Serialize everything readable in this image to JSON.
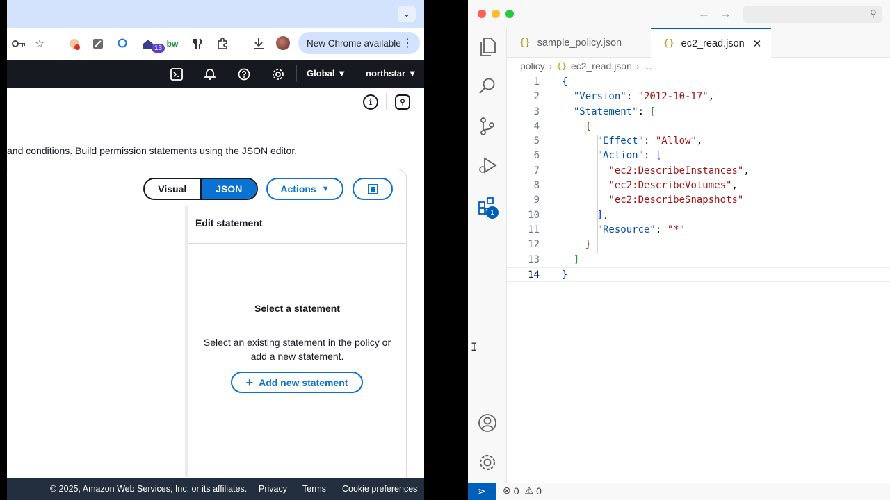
{
  "chrome": {
    "new_chrome_label": "New Chrome available",
    "extension_badge": "13",
    "extension_text_icon": "bw"
  },
  "aws_nav": {
    "region": "Global",
    "account": "northstar"
  },
  "policy_editor": {
    "description": "and conditions. Build permission statements using the JSON editor.",
    "mode_visual": "Visual",
    "mode_json": "JSON",
    "actions_label": "Actions",
    "edit_statement_title": "Edit statement",
    "select_statement_title": "Select a statement",
    "select_statement_desc": "Select an existing statement in the policy or add a new statement.",
    "add_statement_label": "Add new statement"
  },
  "aws_footer": {
    "copyright": "© 2025, Amazon Web Services, Inc. or its affiliates.",
    "privacy": "Privacy",
    "terms": "Terms",
    "cookies": "Cookie preferences"
  },
  "vscode": {
    "tabs": [
      {
        "braces": "{}",
        "label": "sample_policy.json"
      },
      {
        "braces": "{}",
        "label": "ec2_read.json"
      }
    ],
    "breadcrumb": {
      "folder": "policy",
      "braces": "{}",
      "file": "ec2_read.json",
      "more": "..."
    },
    "extensions_badge": "1",
    "line_numbers": [
      "1",
      "2",
      "3",
      "4",
      "5",
      "6",
      "7",
      "8",
      "9",
      "10",
      "11",
      "12",
      "13",
      "14"
    ],
    "status": {
      "errors": "0",
      "warnings": "0"
    }
  },
  "code": {
    "l1_open": "{",
    "version_key": "\"Version\"",
    "version_val": "\"2012-10-17\"",
    "statement_key": "\"Statement\"",
    "statement_open": "[",
    "obj_open": "{",
    "effect_key": "\"Effect\"",
    "effect_val": "\"Allow\"",
    "action_key": "\"Action\"",
    "action_open": "[",
    "action_1": "\"ec2:DescribeInstances\"",
    "action_2": "\"ec2:DescribeVolumes\"",
    "action_3": "\"ec2:DescribeSnapshots\"",
    "action_close": "]",
    "resource_key": "\"Resource\"",
    "resource_val": "\"*\"",
    "obj_close": "}",
    "statement_close": "]",
    "l14_close": "}"
  },
  "colors": {
    "aws_blue": "#0972d3",
    "aws_nav": "#16191f",
    "vscode_accent": "#005fb8"
  }
}
